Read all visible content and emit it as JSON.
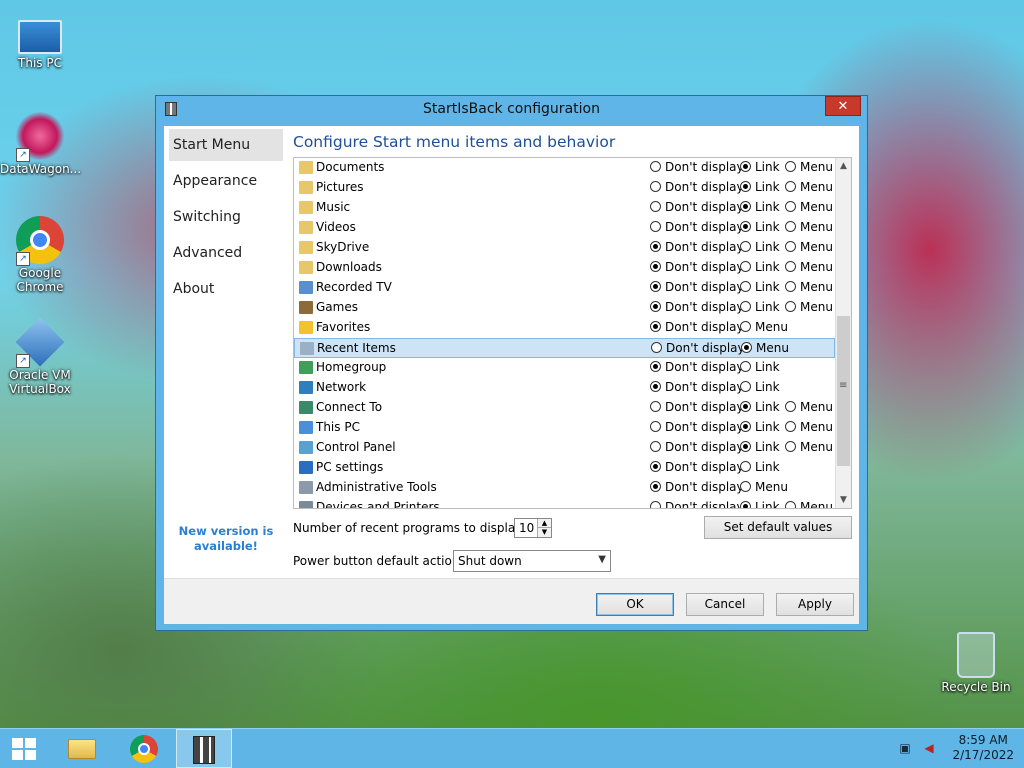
{
  "desktop": {
    "icons": [
      {
        "label": "This PC"
      },
      {
        "label": "DataWagon..."
      },
      {
        "label": "Google Chrome"
      },
      {
        "label": "Oracle VM VirtualBox"
      },
      {
        "label": "Recycle Bin"
      }
    ]
  },
  "window": {
    "title": "StartIsBack configuration",
    "close_label": "✕",
    "nav": [
      {
        "label": "Start Menu",
        "active": true
      },
      {
        "label": "Appearance"
      },
      {
        "label": "Switching"
      },
      {
        "label": "Advanced"
      },
      {
        "label": "About"
      }
    ],
    "new_version": "New version is available!",
    "heading": "Configure Start menu items and behavior",
    "option_labels": {
      "dont": "Don't display",
      "link": "Link",
      "menu": "Menu"
    },
    "items": [
      {
        "label": "Documents",
        "options": [
          "Don't display",
          "Link",
          "Menu"
        ],
        "selected": "Link",
        "icon": "documents-icon",
        "color": "#e8c76a"
      },
      {
        "label": "Pictures",
        "options": [
          "Don't display",
          "Link",
          "Menu"
        ],
        "selected": "Link",
        "icon": "pictures-icon",
        "color": "#e8c76a"
      },
      {
        "label": "Music",
        "options": [
          "Don't display",
          "Link",
          "Menu"
        ],
        "selected": "Link",
        "icon": "music-icon",
        "color": "#e8c76a"
      },
      {
        "label": "Videos",
        "options": [
          "Don't display",
          "Link",
          "Menu"
        ],
        "selected": "Link",
        "icon": "videos-icon",
        "color": "#e8c76a"
      },
      {
        "label": "SkyDrive",
        "options": [
          "Don't display",
          "Link",
          "Menu"
        ],
        "selected": "Don't display",
        "icon": "skydrive-icon",
        "color": "#e8c76a"
      },
      {
        "label": "Downloads",
        "options": [
          "Don't display",
          "Link",
          "Menu"
        ],
        "selected": "Don't display",
        "icon": "downloads-icon",
        "color": "#e8c76a"
      },
      {
        "label": "Recorded TV",
        "options": [
          "Don't display",
          "Link",
          "Menu"
        ],
        "selected": "Don't display",
        "icon": "recorded-tv-icon",
        "color": "#5a8fcf"
      },
      {
        "label": "Games",
        "options": [
          "Don't display",
          "Link",
          "Menu"
        ],
        "selected": "Don't display",
        "icon": "games-icon",
        "color": "#8c6a3a"
      },
      {
        "label": "Favorites",
        "options": [
          "Don't display",
          "Menu"
        ],
        "selected": "Don't display",
        "icon": "favorites-star-icon",
        "color": "#f2c230"
      },
      {
        "label": "Recent Items",
        "options": [
          "Don't display",
          "Menu"
        ],
        "selected": "Menu",
        "icon": "recent-items-icon",
        "color": "#9bb0c4",
        "highlighted": true
      },
      {
        "label": "Homegroup",
        "options": [
          "Don't display",
          "Link"
        ],
        "selected": "Don't display",
        "icon": "homegroup-icon",
        "color": "#3f9f5a"
      },
      {
        "label": "Network",
        "options": [
          "Don't display",
          "Link"
        ],
        "selected": "Don't display",
        "icon": "network-icon",
        "color": "#2f7fbf"
      },
      {
        "label": "Connect To",
        "options": [
          "Don't display",
          "Link",
          "Menu"
        ],
        "selected": "Link",
        "icon": "connect-to-icon",
        "color": "#3a8a6a"
      },
      {
        "label": "This PC",
        "options": [
          "Don't display",
          "Link",
          "Menu"
        ],
        "selected": "Link",
        "icon": "this-pc-icon",
        "color": "#4a8fd8"
      },
      {
        "label": "Control Panel",
        "options": [
          "Don't display",
          "Link",
          "Menu"
        ],
        "selected": "Link",
        "icon": "control-panel-icon",
        "color": "#5aa0d0"
      },
      {
        "label": "PC settings",
        "options": [
          "Don't display",
          "Link"
        ],
        "selected": "Don't display",
        "icon": "pc-settings-gear-icon",
        "color": "#2a6fbf"
      },
      {
        "label": "Administrative Tools",
        "options": [
          "Don't display",
          "Menu"
        ],
        "selected": "Don't display",
        "icon": "administrative-tools-icon",
        "color": "#8a9aaa"
      },
      {
        "label": "Devices and Printers",
        "options": [
          "Don't display",
          "Link",
          "Menu"
        ],
        "selected": "Link",
        "icon": "devices-printers-icon",
        "color": "#7a8a9a"
      }
    ],
    "recent_programs_label": "Number of recent programs to display:",
    "recent_programs_value": "10",
    "set_default_label": "Set default values",
    "power_label": "Power button default action:",
    "power_value": "Shut down",
    "ok_label": "OK",
    "cancel_label": "Cancel",
    "apply_label": "Apply"
  },
  "taskbar": {
    "time": "8:59 AM",
    "date": "2/17/2022"
  },
  "colors": {
    "accent": "#5fb5e8",
    "heading": "#1f4e9a",
    "link": "#2a7fd0",
    "close": "#c7392b"
  }
}
